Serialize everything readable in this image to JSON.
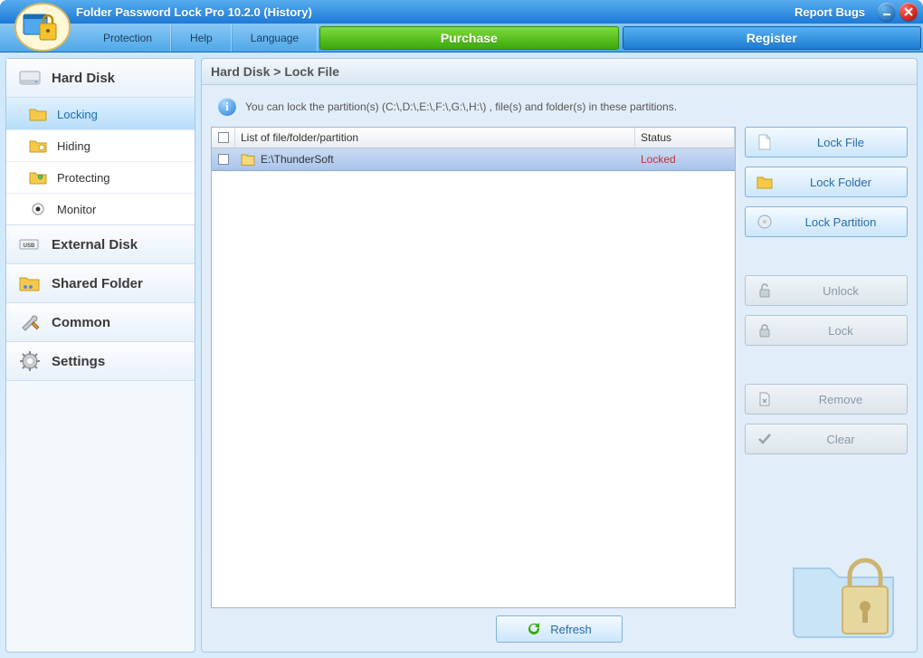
{
  "title": "Folder Password Lock Pro 10.2.0 (History)",
  "report_bugs": "Report Bugs",
  "menu": {
    "protection": "Protection",
    "help": "Help",
    "language": "Language"
  },
  "topbuttons": {
    "purchase": "Purchase",
    "register": "Register"
  },
  "sidebar": {
    "hard_disk": {
      "label": "Hard Disk",
      "items": {
        "locking": "Locking",
        "hiding": "Hiding",
        "protecting": "Protecting",
        "monitor": "Monitor"
      }
    },
    "external_disk": "External Disk",
    "shared_folder": "Shared Folder",
    "common": "Common",
    "settings": "Settings"
  },
  "breadcrumb": "Hard Disk > Lock File",
  "info_text": "You can lock the partition(s)  (C:\\,D:\\,E:\\,F:\\,G:\\,H:\\) , file(s) and folder(s) in these partitions.",
  "columns": {
    "name": "List of file/folder/partition",
    "status": "Status"
  },
  "rows": [
    {
      "name": "E:\\ThunderSoft",
      "status": "Locked"
    }
  ],
  "actions": {
    "lock_file": "Lock File",
    "lock_folder": "Lock Folder",
    "lock_partition": "Lock Partition",
    "unlock": "Unlock",
    "lock": "Lock",
    "remove": "Remove",
    "clear": "Clear"
  },
  "refresh": "Refresh"
}
